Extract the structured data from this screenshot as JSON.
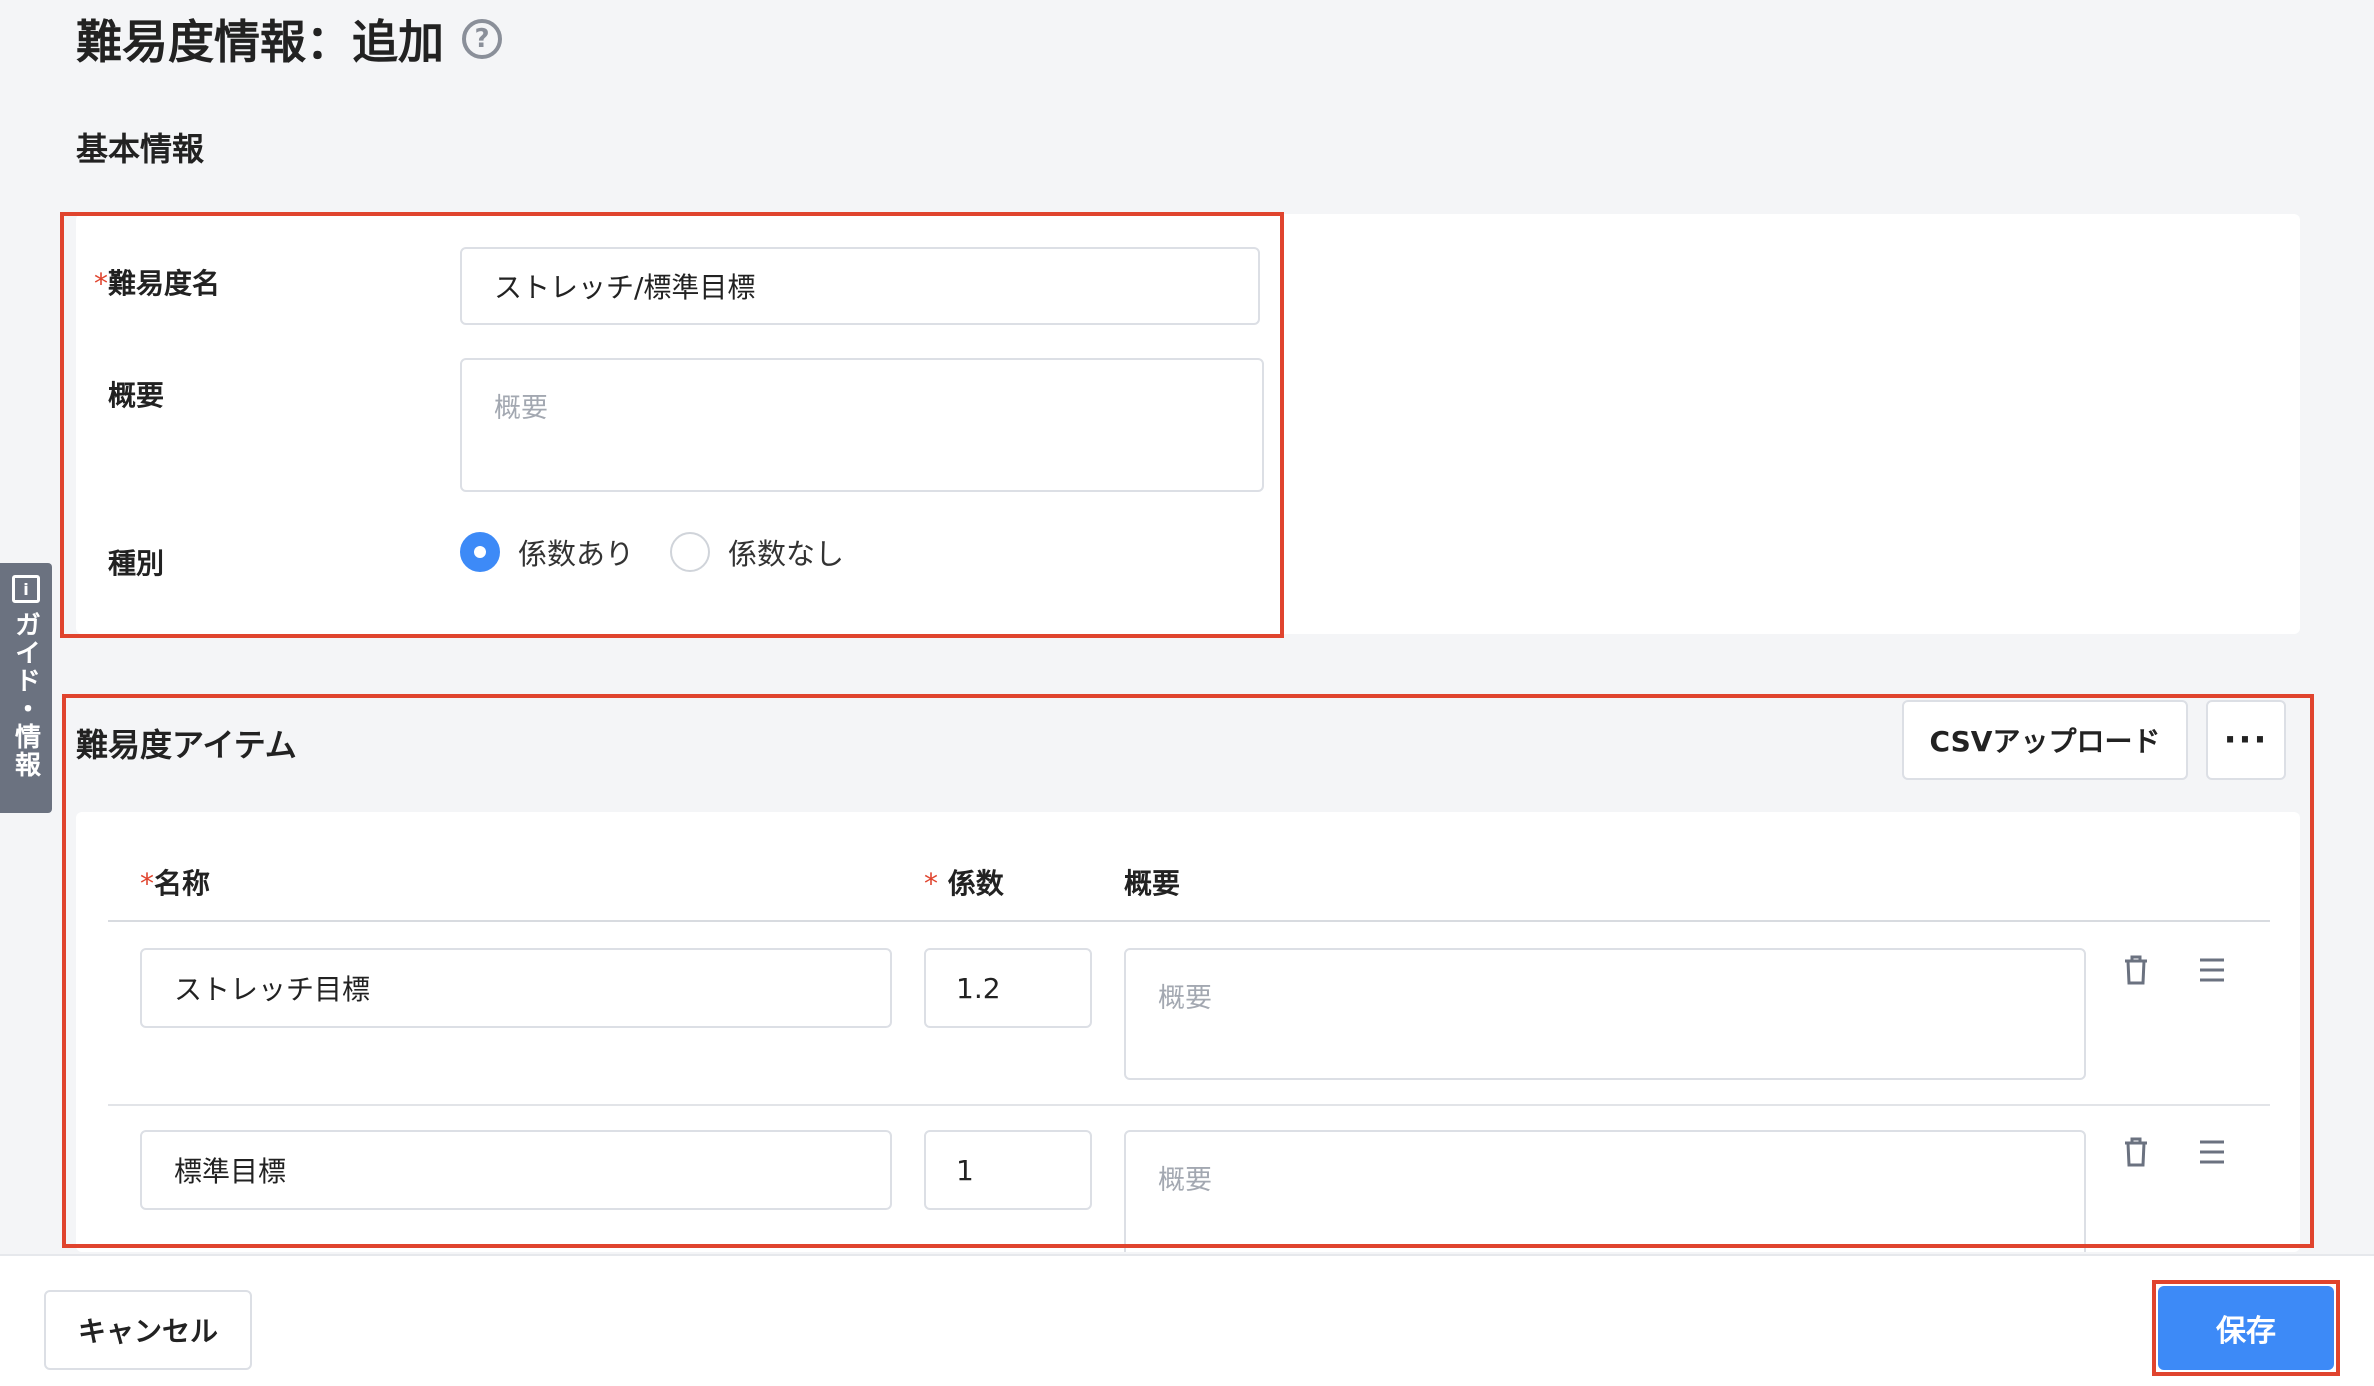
{
  "page": {
    "title": "難易度情報：追加",
    "help_icon": "?"
  },
  "basic": {
    "section_label": "基本情報",
    "name_label": "難易度名",
    "name_required": "*",
    "name_value": "ストレッチ/標準目標",
    "summary_label": "概要",
    "summary_placeholder": "概要",
    "type_label": "種別",
    "type_options": [
      "係数あり",
      "係数なし"
    ],
    "type_selected": "係数あり"
  },
  "guide_tab": {
    "label": "ガイド・情報"
  },
  "items": {
    "title": "難易度アイテム",
    "csv_button": "CSVアップロード",
    "more_button": "···",
    "columns": {
      "name": "名称",
      "name_required": "*",
      "coef": "係数",
      "coef_required": "*",
      "summary": "概要"
    },
    "rows": [
      {
        "name": "ストレッチ目標",
        "coef": "1.2",
        "summary_placeholder": "概要"
      },
      {
        "name": "標準目標",
        "coef": "1",
        "summary_placeholder": "概要"
      }
    ]
  },
  "footer": {
    "cancel_label": "キャンセル",
    "save_label": "保存"
  },
  "colors": {
    "accent": "#3d8af7",
    "highlight": "#e0442e",
    "background": "#f4f5f7"
  }
}
